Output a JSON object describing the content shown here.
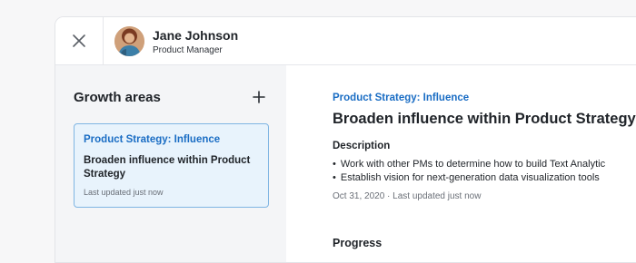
{
  "header": {
    "close_icon": "close-icon",
    "user": {
      "name": "Jane Johnson",
      "role": "Product Manager"
    }
  },
  "sidebar": {
    "title": "Growth areas",
    "add_icon": "plus-icon",
    "items": [
      {
        "category": "Product Strategy: Influence",
        "title": "Broaden influence within Product Strategy",
        "updated": "Last updated just now",
        "selected": true
      }
    ]
  },
  "detail": {
    "category": "Product Strategy: Influence",
    "title": "Broaden influence within Product Strategy",
    "description_heading": "Description",
    "description_items": [
      "Work with other PMs to determine how to build Text Analytic",
      "Establish vision for next-generation data visualization tools"
    ],
    "meta": "Oct 31, 2020 · Last updated just now",
    "progress_heading": "Progress"
  },
  "colors": {
    "accent": "#1a6dc4",
    "card_bg": "#e8f3fc",
    "card_border": "#7fb5e3",
    "sidebar_bg": "#f4f5f7"
  }
}
